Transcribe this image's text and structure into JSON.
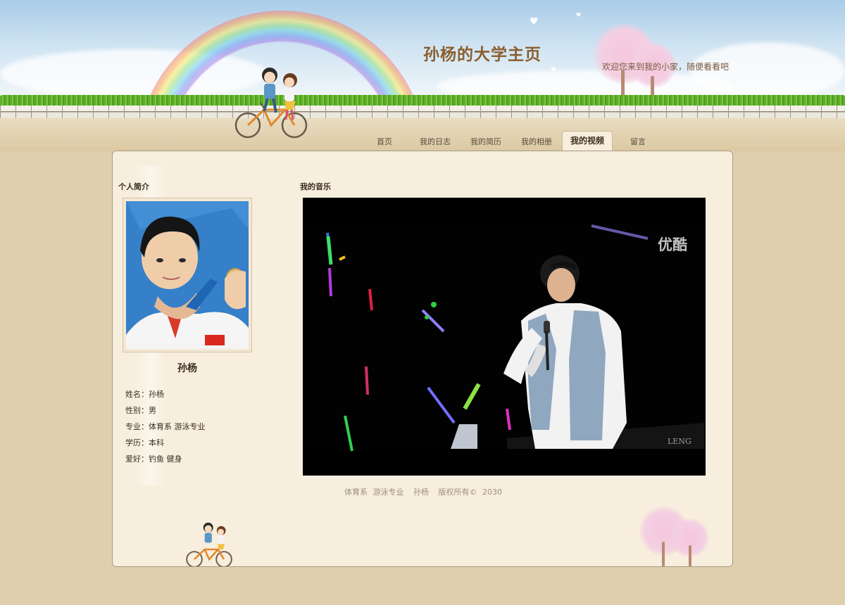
{
  "header": {
    "site_title": "孙杨的大学主页",
    "tagline": "欢迎您来到我的小家，随便看看吧"
  },
  "nav": {
    "items": [
      {
        "label": "首页",
        "active": false
      },
      {
        "label": "我的日志",
        "active": false
      },
      {
        "label": "我的简历",
        "active": false
      },
      {
        "label": "我的相册",
        "active": false
      },
      {
        "label": "我的视频",
        "active": true
      },
      {
        "label": "留言",
        "active": false
      }
    ]
  },
  "profile": {
    "section_title": "个人简介",
    "name": "孙杨",
    "fields": [
      {
        "label": "姓名：",
        "value": "孙杨"
      },
      {
        "label": "性别：",
        "value": "男"
      },
      {
        "label": "专业：",
        "value": "体育系 游泳专业"
      },
      {
        "label": "学历：",
        "value": "本科"
      },
      {
        "label": "爱好：",
        "value": "钓鱼 健身"
      }
    ]
  },
  "media": {
    "section_title": "我的音乐",
    "video_watermark": "优酷"
  },
  "footer": {
    "department": "体育系 游泳专业",
    "name": "孙杨",
    "copyright": "版权所有© 2030"
  },
  "colors": {
    "page_bg": "#dfcfae",
    "panel_bg": "#f7eedd",
    "title_color": "#8a5e2e",
    "video_bg": "#000000"
  }
}
